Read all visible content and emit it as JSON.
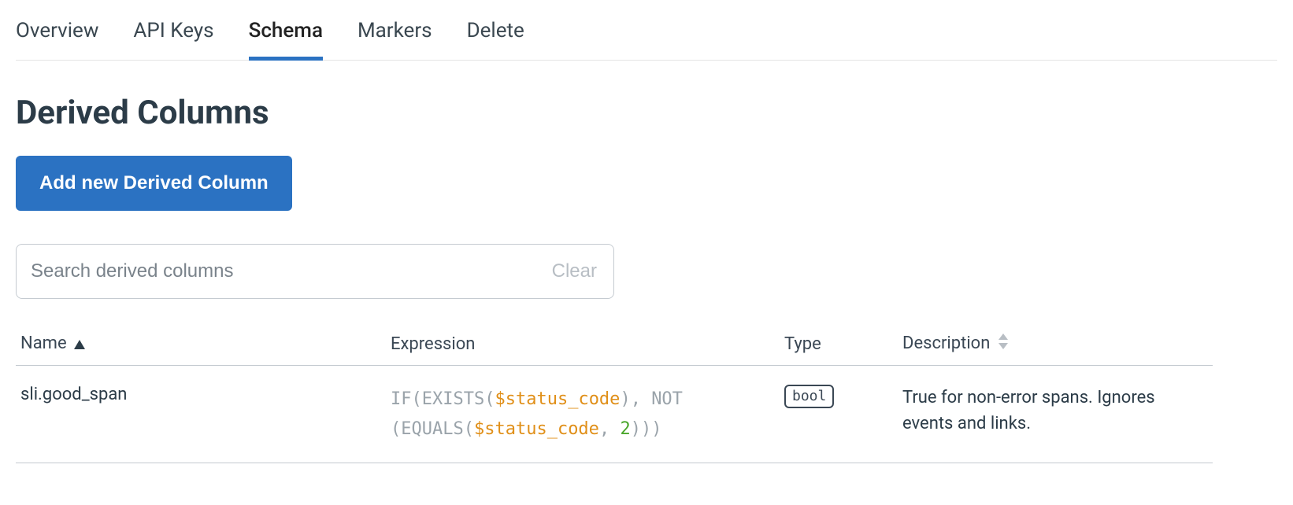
{
  "tabs": {
    "items": [
      {
        "label": "Overview",
        "active": false
      },
      {
        "label": "API Keys",
        "active": false
      },
      {
        "label": "Schema",
        "active": true
      },
      {
        "label": "Markers",
        "active": false
      },
      {
        "label": "Delete",
        "active": false
      }
    ]
  },
  "page": {
    "title": "Derived Columns",
    "add_button_label": "Add new Derived Column"
  },
  "search": {
    "placeholder": "Search derived columns",
    "clear_label": "Clear"
  },
  "table": {
    "headers": {
      "name": "Name",
      "expression": "Expression",
      "type": "Type",
      "description": "Description"
    },
    "rows": [
      {
        "name": "sli.good_span",
        "expression_tokens": [
          {
            "t": "kw",
            "v": "IF"
          },
          {
            "t": "p",
            "v": "("
          },
          {
            "t": "kw",
            "v": "EXISTS"
          },
          {
            "t": "p",
            "v": "("
          },
          {
            "t": "var",
            "v": "$status_code"
          },
          {
            "t": "p",
            "v": ")"
          },
          {
            "t": "p",
            "v": ", "
          },
          {
            "t": "kw",
            "v": "NOT"
          },
          {
            "t": "br",
            "v": ""
          },
          {
            "t": "p",
            "v": "("
          },
          {
            "t": "kw",
            "v": "EQUALS"
          },
          {
            "t": "p",
            "v": "("
          },
          {
            "t": "var",
            "v": "$status_code"
          },
          {
            "t": "p",
            "v": ", "
          },
          {
            "t": "num",
            "v": "2"
          },
          {
            "t": "p",
            "v": ")"
          },
          {
            "t": "p",
            "v": ")"
          },
          {
            "t": "p",
            "v": ")"
          }
        ],
        "type": "bool",
        "description": "True for non-error spans. Ignores events and links."
      }
    ]
  }
}
